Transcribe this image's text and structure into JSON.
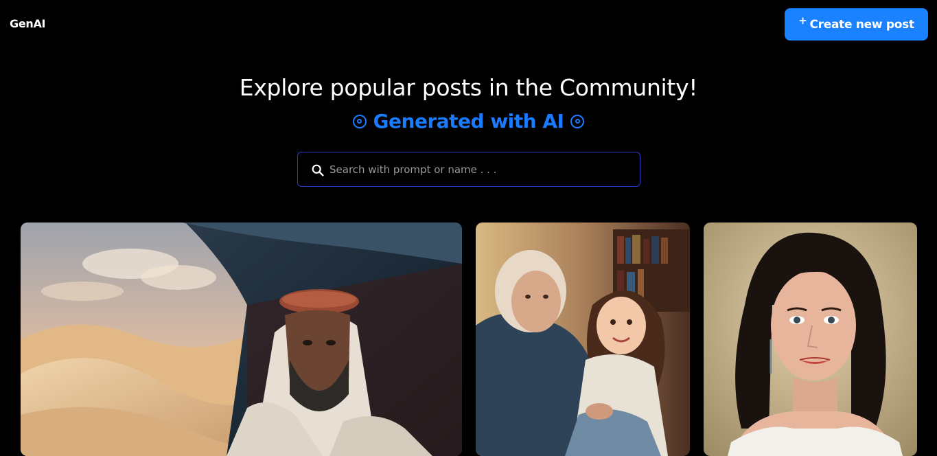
{
  "nav": {
    "logo": "GenAI",
    "create_button": {
      "icon": "plus-icon",
      "plus": "+",
      "label": "Create new post"
    }
  },
  "hero": {
    "title": "Explore popular posts in the Community!",
    "subtitle": "Generated with AI",
    "subtitle_icon": "target-icon"
  },
  "search": {
    "icon": "search-icon",
    "placeholder": "Search with prompt or name . . ."
  },
  "colors": {
    "background": "#000000",
    "accent": "#1a7bff",
    "button": "#1a82ff",
    "search_border": "#2a3cc7"
  },
  "posts": [
    {
      "subject": "man in keffiyeh in desert tent"
    },
    {
      "subject": "elderly woman with young girl"
    },
    {
      "subject": "portrait of dark-haired woman"
    }
  ]
}
